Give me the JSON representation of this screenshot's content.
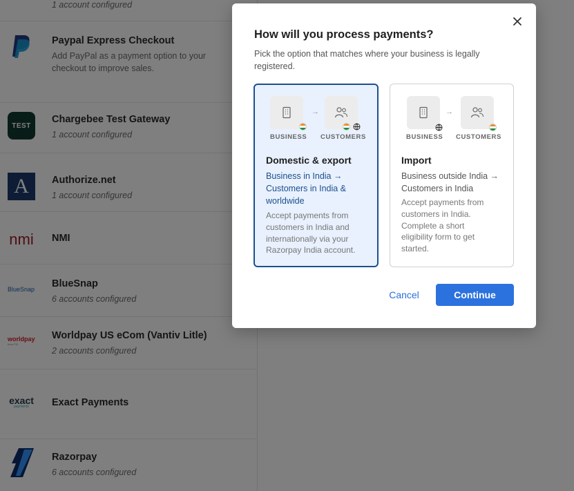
{
  "gateways": [
    {
      "sub": "1 account configured"
    },
    {
      "name": "Paypal Express Checkout",
      "desc": "Add PayPal as a payment option to your checkout to improve sales."
    },
    {
      "name": "Chargebee Test Gateway",
      "sub": "1 account configured",
      "logo_text": "TEST"
    },
    {
      "name": "Authorize.net",
      "sub": "1 account configured",
      "logo_text": "A"
    },
    {
      "name": "NMI",
      "logo_text": "nmi"
    },
    {
      "name": "BlueSnap",
      "sub": "6 accounts configured",
      "logo_text": "BlueSnap"
    },
    {
      "name": "Worldpay US eCom (Vantiv Litle)",
      "sub": "2 accounts configured",
      "logo_text": "worldpay",
      "logo_subtext": "from FIS"
    },
    {
      "name": "Exact Payments",
      "logo_text": "exact",
      "logo_subtext": "payments"
    },
    {
      "name": "Razorpay",
      "sub": "6 accounts configured"
    }
  ],
  "modal": {
    "title": "How will you process payments?",
    "subtitle": "Pick the option that matches where your business is legally registered.",
    "options": [
      {
        "title": "Domestic & export",
        "subline": "Business in India → Customers in India & worldwide",
        "description": "Accept payments from customers in India and internationally via your Razorpay India account.",
        "business_label": "BUSINESS",
        "customers_label": "CUSTOMERS",
        "selected": true
      },
      {
        "title": "Import",
        "subline": "Business outside India → Customers in India",
        "description": "Accept payments from customers in India. Complete a short eligibility form to get started.",
        "business_label": "BUSINESS",
        "customers_label": "CUSTOMERS",
        "selected": false
      }
    ],
    "cancel_label": "Cancel",
    "continue_label": "Continue"
  },
  "colors": {
    "primary": "#2b72de",
    "selected_border": "#1c4f8f",
    "selected_bg": "#e8f1fd",
    "link": "#2a6fdb"
  },
  "icons": [
    "close-icon",
    "paypal-icon",
    "building-icon",
    "users-icon",
    "india-flag-icon",
    "globe-icon",
    "arrow-right-icon",
    "razorpay-icon"
  ]
}
